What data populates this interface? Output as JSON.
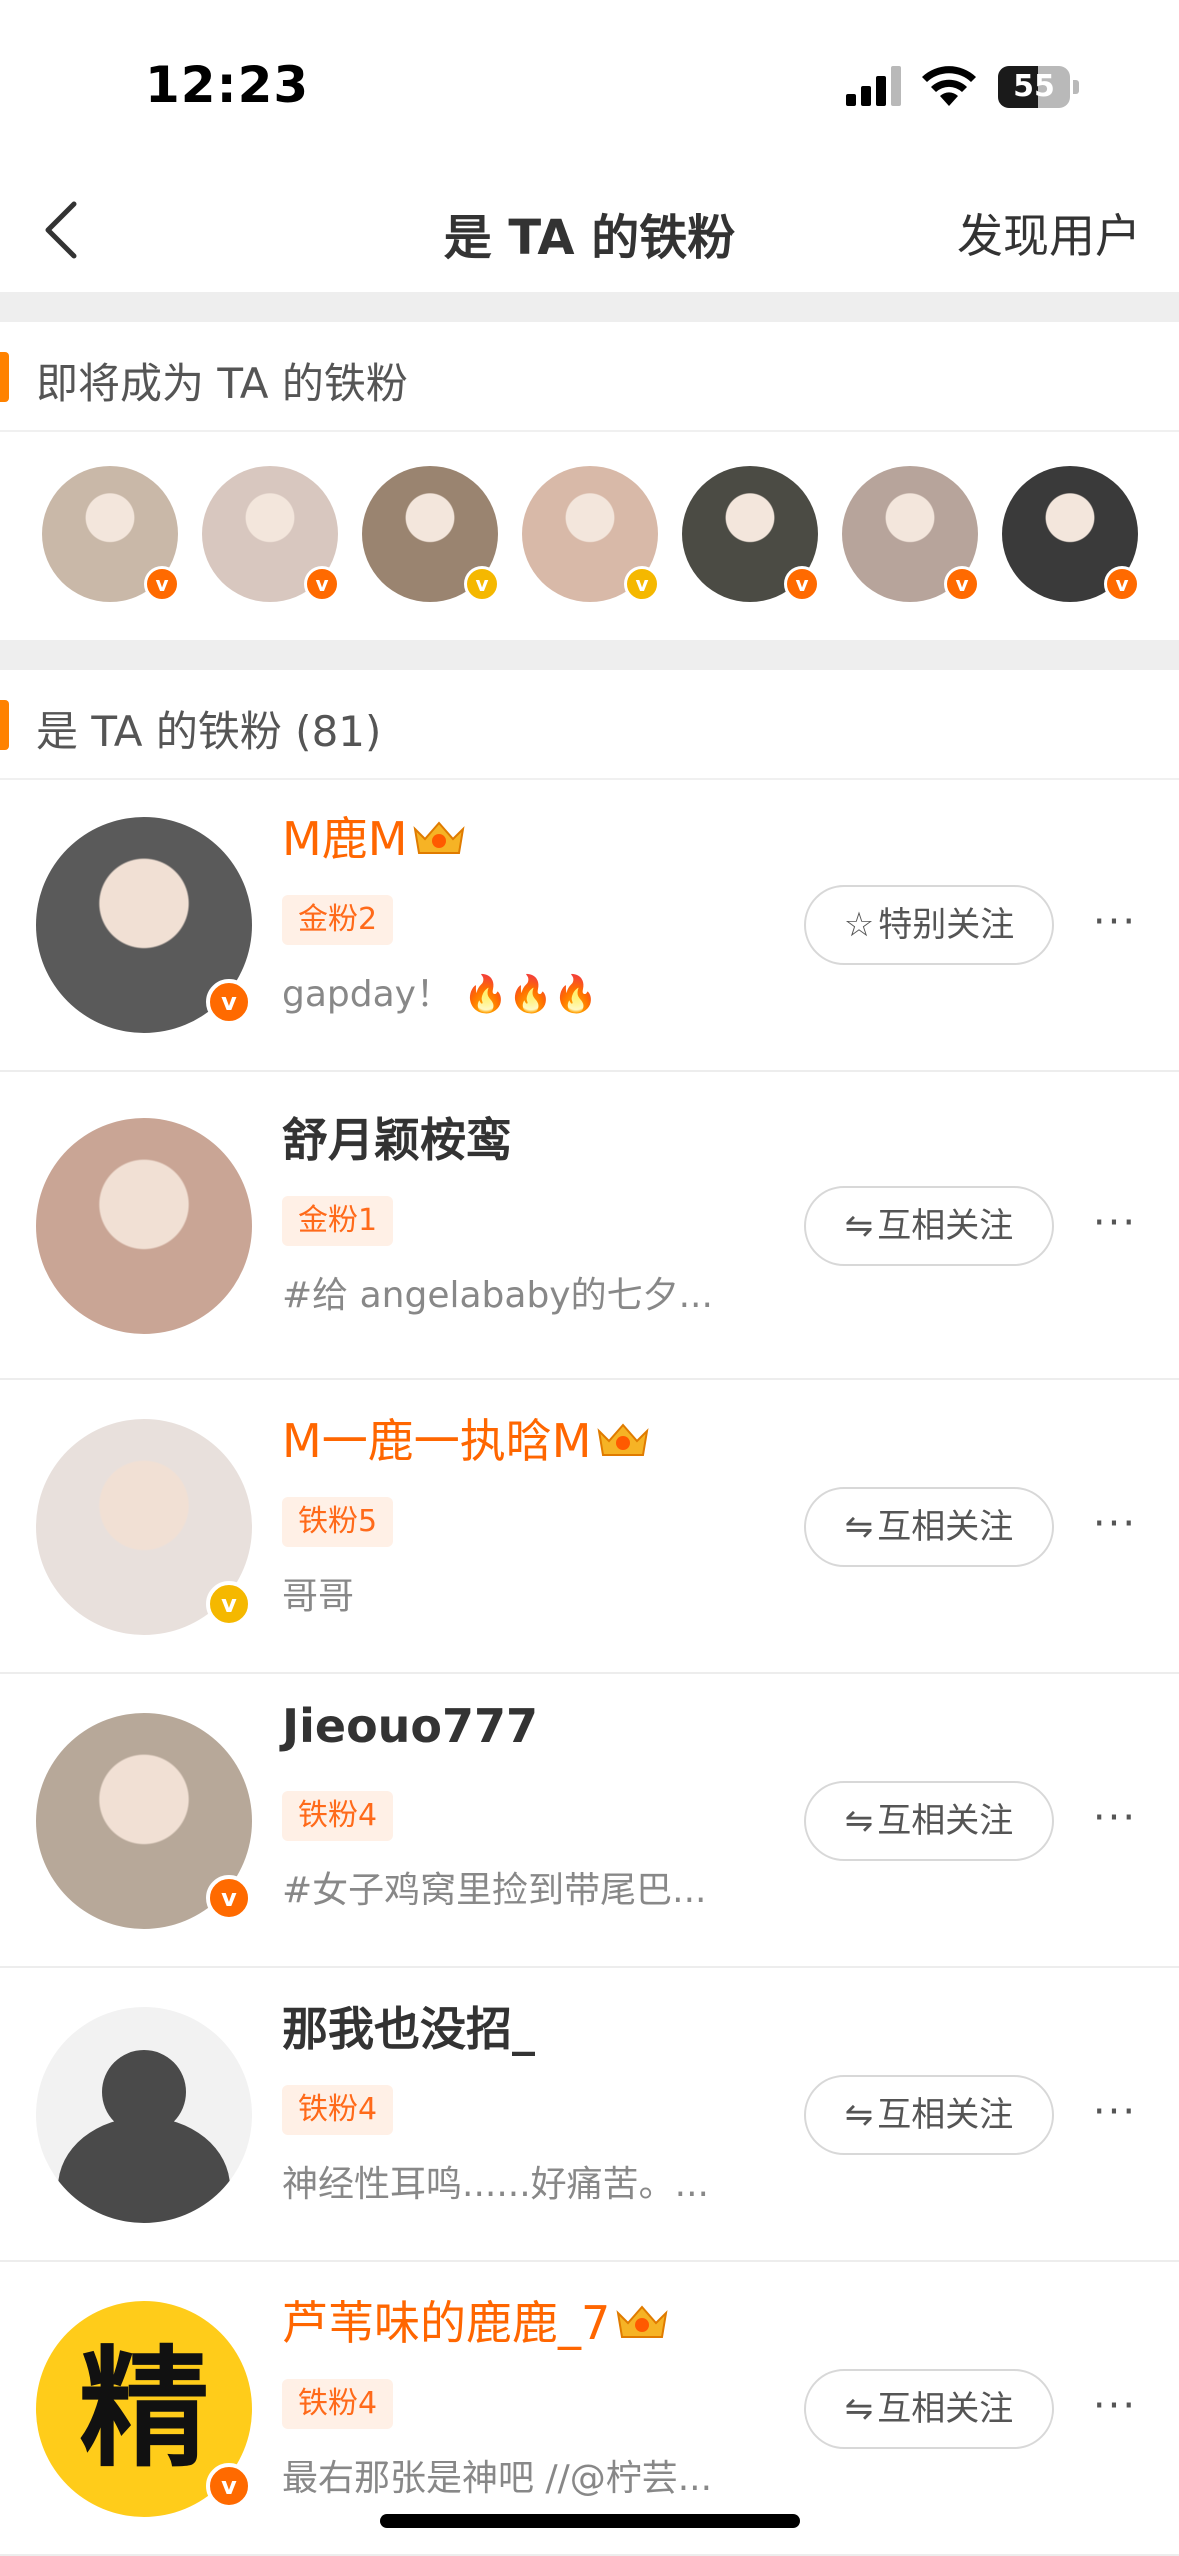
{
  "status_bar": {
    "time": "12:23",
    "battery": "55",
    "battery_level": 0.55
  },
  "nav": {
    "title": "是 TA 的铁粉",
    "right_action": "发现用户"
  },
  "upcoming_section": {
    "title": "即将成为 TA 的铁粉",
    "avatars": [
      {
        "badge": "v",
        "badge_color": "#ff6a00",
        "bg": "#c9b8a8"
      },
      {
        "badge": "v",
        "badge_color": "#ff6a00",
        "bg": "#d8c7bf"
      },
      {
        "badge": "v",
        "badge_color": "#f5b800",
        "bg": "#9a8470"
      },
      {
        "badge": "v",
        "badge_color": "#f5b800",
        "bg": "#d8b9a8"
      },
      {
        "badge": "v",
        "badge_color": "#ff6a00",
        "bg": "#4b4b44"
      },
      {
        "badge": "v",
        "badge_color": "#ff6a00",
        "bg": "#b7a49b"
      },
      {
        "badge": "v",
        "badge_color": "#ff6a00",
        "bg": "#3a3a3a"
      }
    ]
  },
  "fans_section": {
    "title": "是 TA 的铁粉 (81)",
    "rows": [
      {
        "name": "M鹿M",
        "vip": true,
        "tag": "金粉2",
        "desc": "gapday！ 🔥🔥🔥",
        "button": "特别关注",
        "button_icon": "☆",
        "badge_color": "#ff6a00",
        "avatar_bg": "#5a5a5a",
        "more": "···"
      },
      {
        "name": "舒月颖桉鸾",
        "vip": false,
        "tag": "金粉1",
        "desc": "#给 angelababy的七夕...",
        "button": "互相关注",
        "button_icon": "⇋",
        "badge_color": "",
        "avatar_bg": "#c9a595",
        "more": "···"
      },
      {
        "name": "M一鹿一执晗M",
        "vip": true,
        "tag": "铁粉5",
        "desc": "哥哥",
        "button": "互相关注",
        "button_icon": "⇋",
        "badge_color": "#f5b800",
        "avatar_bg": "#e8e0dc",
        "more": "···"
      },
      {
        "name": "Jieouo777",
        "vip": false,
        "tag": "铁粉4",
        "desc": "#女子鸡窝里捡到带尾巴...",
        "button": "互相关注",
        "button_icon": "⇋",
        "badge_color": "#ff6a00",
        "avatar_bg": "#b7a899",
        "more": "···"
      },
      {
        "name": "那我也没招_",
        "vip": false,
        "tag": "铁粉4",
        "desc": "神经性耳鸣......好痛苦。...",
        "button": "互相关注",
        "button_icon": "⇋",
        "badge_color": "",
        "avatar_bg": "#f2f2f2",
        "more": "···"
      },
      {
        "name": "芦苇味的鹿鹿_7",
        "vip": true,
        "tag": "铁粉4",
        "desc": "最右那张是神吧 //@柠芸...",
        "button": "互相关注",
        "button_icon": "⇋",
        "badge_color": "#ff6a00",
        "avatar_bg": "#ffcc1a",
        "avatar_text": "精",
        "more": "···"
      }
    ]
  }
}
